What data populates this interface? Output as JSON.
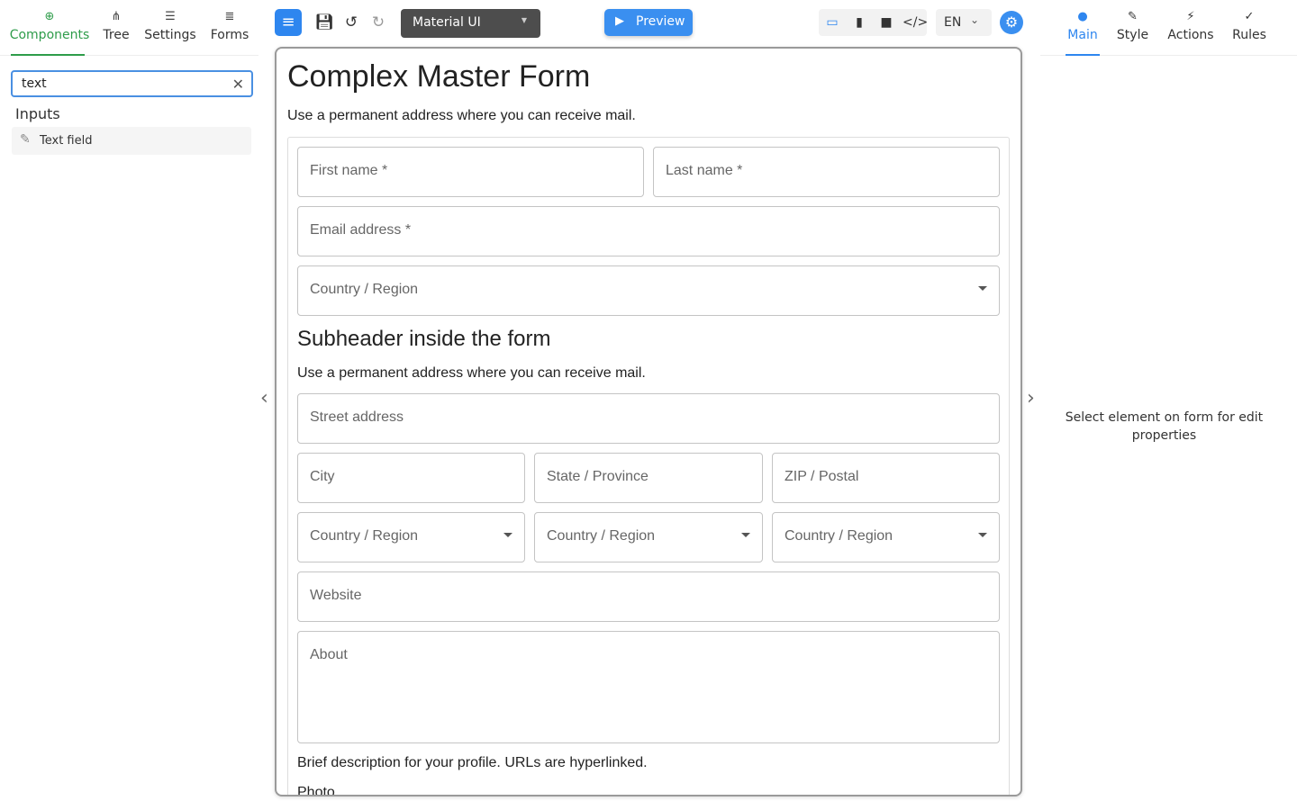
{
  "left_tabs": [
    {
      "label": "Components",
      "icon": "plus-circle-icon"
    },
    {
      "label": "Tree",
      "icon": "tree-icon"
    },
    {
      "label": "Settings",
      "icon": "sliders-icon"
    },
    {
      "label": "Forms",
      "icon": "list-icon"
    }
  ],
  "search": {
    "value": "text"
  },
  "components": {
    "group": "Inputs",
    "items": [
      {
        "label": "Text field",
        "icon": "edit-icon"
      }
    ]
  },
  "toolbar": {
    "theme": "Material UI",
    "preview_label": "Preview",
    "language": "EN",
    "accent": "#2e86ef"
  },
  "form": {
    "title": "Complex Master Form",
    "subtitle": "Use a permanent address where you can receive mail.",
    "first_name": "First name *",
    "last_name": "Last name *",
    "email": "Email address *",
    "country": "Country / Region",
    "subheader": "Subheader inside the form",
    "subheader_text": "Use a permanent address where you can receive mail.",
    "street": "Street address",
    "city": "City",
    "state": "State / Province",
    "zip": "ZIP / Postal",
    "country_a": "Country / Region",
    "country_b": "Country / Region",
    "country_c": "Country / Region",
    "website": "Website",
    "about": "About",
    "about_help": "Brief description for your profile. URLs are hyperlinked.",
    "photo": "Photo"
  },
  "right_tabs": [
    {
      "label": "Main",
      "icon": "circle-icon"
    },
    {
      "label": "Style",
      "icon": "brush-icon"
    },
    {
      "label": "Actions",
      "icon": "bolt-icon"
    },
    {
      "label": "Rules",
      "icon": "rules-icon"
    }
  ],
  "right_hint": "Select element on form for edit properties"
}
